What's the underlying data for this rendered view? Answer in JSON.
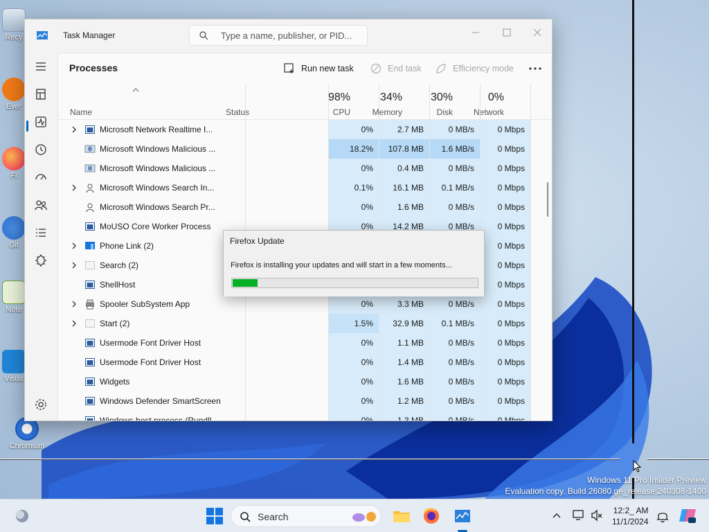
{
  "desktop": {
    "icons": [
      {
        "label": "Recy",
        "name": "recycle-bin"
      },
      {
        "label": "Ever",
        "name": "everything"
      },
      {
        "label": "Fi",
        "name": "firefox"
      },
      {
        "label": "Git",
        "name": "git"
      },
      {
        "label": "Note",
        "name": "notepad-plus-plus"
      },
      {
        "label": "Visua",
        "name": "visual-studio-code"
      },
      {
        "label": "Chromium",
        "name": "chromium"
      }
    ],
    "watermark": {
      "line1": "Windows 11 Pro Insider Preview",
      "line2": "Evaluation copy. Build 26080.ge_release.240308-1400"
    }
  },
  "task_manager": {
    "title": "Task Manager",
    "search_placeholder": "Type a name, publisher, or PID...",
    "page_title": "Processes",
    "toolbar": {
      "run_new_task": "Run new task",
      "end_task": "End task",
      "efficiency_mode": "Efficiency mode"
    },
    "columns": {
      "name": "Name",
      "status": "Status",
      "cpu": {
        "label": "CPU",
        "pct": "98%"
      },
      "memory": {
        "label": "Memory",
        "pct": "34%"
      },
      "disk": {
        "label": "Disk",
        "pct": "30%"
      },
      "network": {
        "label": "Network",
        "pct": "0%"
      }
    },
    "rows": [
      {
        "name": "Microsoft Network Realtime I...",
        "expand": true,
        "cpu": "0%",
        "memory": "2.7 MB",
        "disk": "0 MB/s",
        "network": "0 Mbps"
      },
      {
        "name": "Microsoft Windows Malicious ...",
        "expand": false,
        "cpu": "18.2%",
        "memory": "107.8 MB",
        "disk": "1.6 MB/s",
        "network": "0 Mbps"
      },
      {
        "name": "Microsoft Windows Malicious ...",
        "expand": false,
        "cpu": "0%",
        "memory": "0.4 MB",
        "disk": "0 MB/s",
        "network": "0 Mbps"
      },
      {
        "name": "Microsoft Windows Search In...",
        "expand": true,
        "cpu": "0.1%",
        "memory": "16.1 MB",
        "disk": "0.1 MB/s",
        "network": "0 Mbps"
      },
      {
        "name": "Microsoft Windows Search Pr...",
        "expand": false,
        "cpu": "0%",
        "memory": "1.6 MB",
        "disk": "0 MB/s",
        "network": "0 Mbps"
      },
      {
        "name": "MoUSO Core Worker Process",
        "expand": false,
        "cpu": "0%",
        "memory": "14.2 MB",
        "disk": "0 MB/s",
        "network": "0 Mbps"
      },
      {
        "name": "Phone Link (2)",
        "expand": true,
        "cpu": "",
        "memory": "",
        "disk": "",
        "network": "0 Mbps"
      },
      {
        "name": "Search (2)",
        "expand": true,
        "cpu": "",
        "memory": "",
        "disk": "",
        "network": "0 Mbps"
      },
      {
        "name": "ShellHost",
        "expand": false,
        "cpu": "",
        "memory": "",
        "disk": "",
        "network": "0 Mbps"
      },
      {
        "name": "Spooler SubSystem App",
        "expand": true,
        "cpu": "0%",
        "memory": "3.3 MB",
        "disk": "0 MB/s",
        "network": "0 Mbps"
      },
      {
        "name": "Start (2)",
        "expand": true,
        "cpu": "1.5%",
        "memory": "32.9 MB",
        "disk": "0.1 MB/s",
        "network": "0 Mbps"
      },
      {
        "name": "Usermode Font Driver Host",
        "expand": false,
        "cpu": "0%",
        "memory": "1.1 MB",
        "disk": "0 MB/s",
        "network": "0 Mbps"
      },
      {
        "name": "Usermode Font Driver Host",
        "expand": false,
        "cpu": "0%",
        "memory": "1.4 MB",
        "disk": "0 MB/s",
        "network": "0 Mbps"
      },
      {
        "name": "Widgets",
        "expand": false,
        "cpu": "0%",
        "memory": "1.6 MB",
        "disk": "0 MB/s",
        "network": "0 Mbps"
      },
      {
        "name": "Windows Defender SmartScreen",
        "expand": false,
        "cpu": "0%",
        "memory": "1.2 MB",
        "disk": "0 MB/s",
        "network": "0 Mbps"
      },
      {
        "name": "Windows host process (Rundll...",
        "expand": false,
        "cpu": "0%",
        "memory": "1.3 MB",
        "disk": "0 MB/s",
        "network": "0 Mbps"
      }
    ]
  },
  "firefox_dialog": {
    "title": "Firefox Update",
    "message": "Firefox is installing your updates and will start in a few moments...",
    "progress_fraction": 0.1
  },
  "taskbar": {
    "search_label": "Search",
    "time": "12:2_ AM",
    "date": "11/1/2024"
  },
  "colors": {
    "accent": "#0067c0",
    "progress_green": "#06b025",
    "heat_low": "#d7ebfa",
    "heat_high": "#b5d9f6"
  }
}
